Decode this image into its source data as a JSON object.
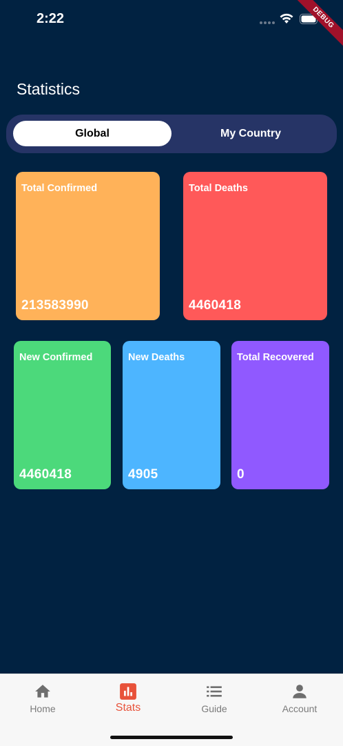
{
  "status_bar": {
    "time": "2:22",
    "debug_label": "DEBUG"
  },
  "page": {
    "title": "Statistics"
  },
  "segmented": {
    "options": [
      "Global",
      "My Country"
    ],
    "selected": "Global"
  },
  "cards": [
    {
      "label": "Total Confirmed",
      "value": "213583990",
      "color": "#FFB259"
    },
    {
      "label": "Total Deaths",
      "value": "4460418",
      "color": "#FF5959"
    },
    {
      "label": "New Confirmed",
      "value": "4460418",
      "color": "#4CD97B"
    },
    {
      "label": "New Deaths",
      "value": "4905",
      "color": "#4DB5FF"
    },
    {
      "label": "Total Recovered",
      "value": "0",
      "color": "#9059FF"
    }
  ],
  "bottom_nav": {
    "items": [
      {
        "label": "Home",
        "icon": "home-icon"
      },
      {
        "label": "Stats",
        "icon": "bar-chart-icon"
      },
      {
        "label": "Guide",
        "icon": "list-icon"
      },
      {
        "label": "Account",
        "icon": "person-icon"
      }
    ],
    "active": "Stats",
    "active_color": "#E8523A",
    "inactive_color": "#7B7B7B"
  }
}
